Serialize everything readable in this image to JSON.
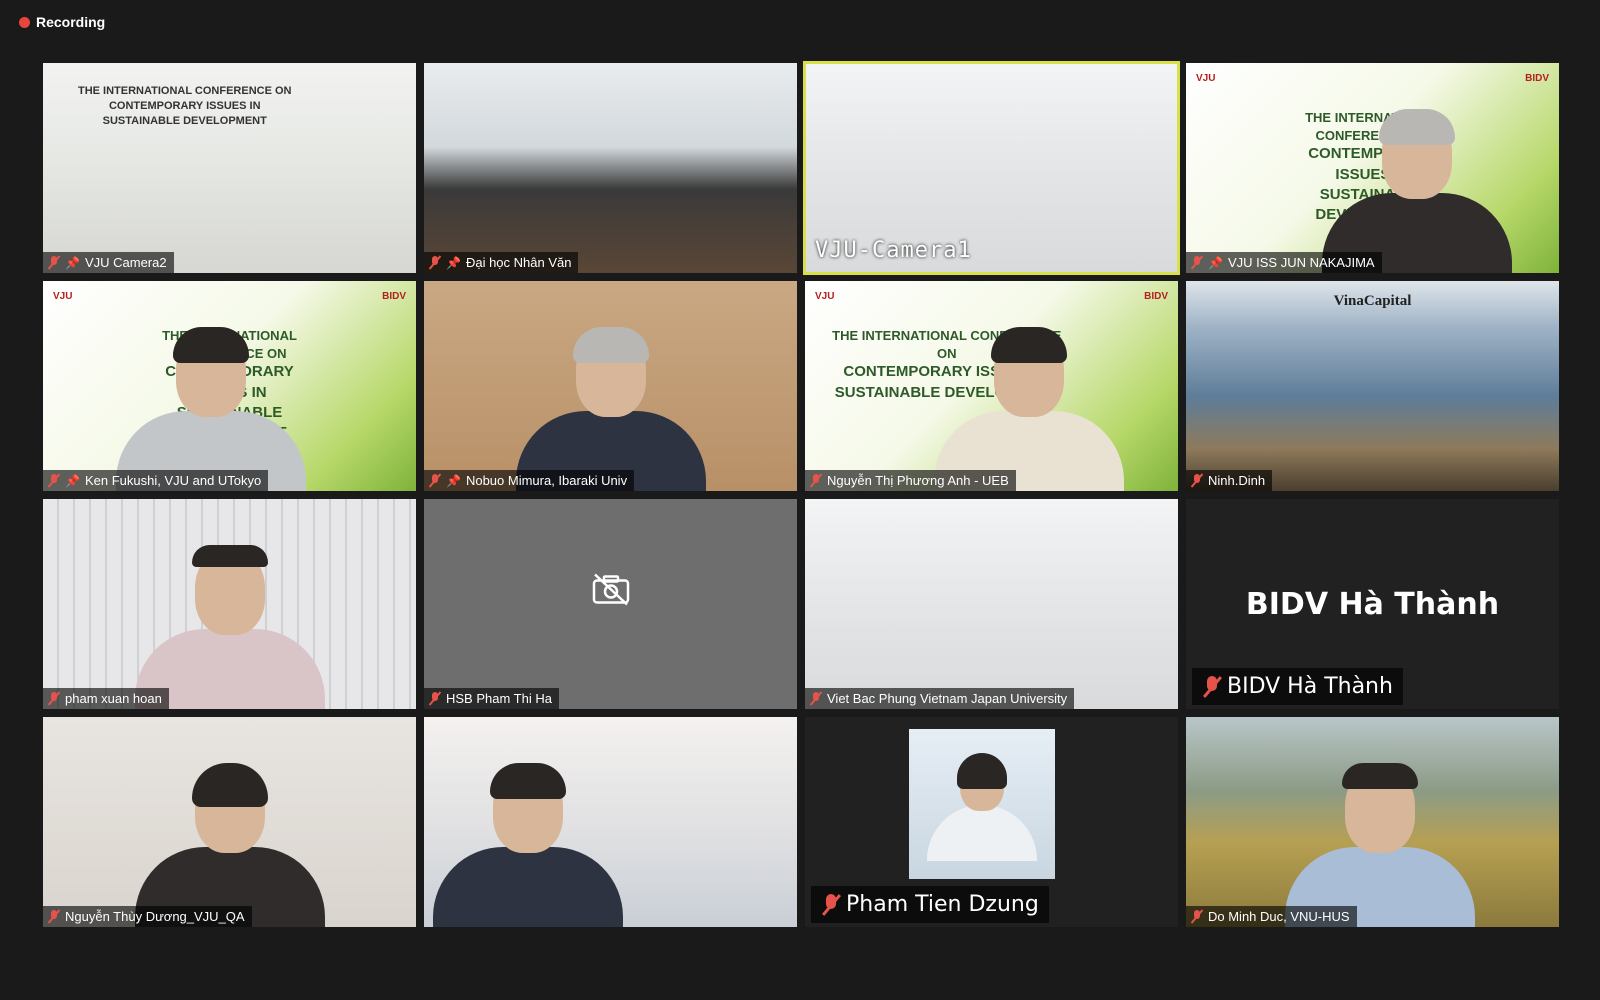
{
  "recording": {
    "label": "Recording",
    "dot_color": "#e8453c"
  },
  "tiles": [
    {
      "name": "VJU Camera2",
      "mic": "muted",
      "pinned": true
    },
    {
      "name": "Đại học Nhân Văn",
      "mic": "muted",
      "pinned": true
    },
    {
      "name": "VJU-Camera1",
      "mic": "muted",
      "pinned": false,
      "active_speaker": true
    },
    {
      "name": "VJU ISS JUN NAKAJIMA",
      "mic": "muted",
      "pinned": true
    },
    {
      "name": "Ken Fukushi, VJU and UTokyo",
      "mic": "muted",
      "pinned": true
    },
    {
      "name": "Nobuo Mimura, Ibaraki Univ",
      "mic": "muted",
      "pinned": true
    },
    {
      "name": "Nguyễn Thị Phương Anh - UEB",
      "mic": "muted",
      "pinned": false
    },
    {
      "name": "Ninh.Dinh",
      "mic": "muted",
      "pinned": false
    },
    {
      "name": "pham xuan hoan",
      "mic": "muted",
      "pinned": false
    },
    {
      "name": "HSB Pham Thi Ha",
      "mic": "muted",
      "pinned": false,
      "camera": "off"
    },
    {
      "name": "Viet Bac Phung Vietnam Japan University",
      "mic": "muted",
      "pinned": false
    },
    {
      "name": "BIDV Hà Thành",
      "mic": "muted",
      "pinned": false
    },
    {
      "name": "Nguyễn Thùy Dương_VJU_QA",
      "mic": "muted",
      "pinned": false
    },
    {
      "name": "",
      "mic": "none",
      "pinned": false
    },
    {
      "name": "Pham Tien Dzung",
      "mic": "muted",
      "pinned": false
    },
    {
      "name": "Do Minh Duc, VNU-HUS",
      "mic": "muted",
      "pinned": false
    }
  ],
  "bidv_display": "BIDV Hà Thành",
  "vinacapital_logo": "VinaCapital",
  "banner": {
    "vju_logo": "VJU",
    "bidv_logo": "BIDV",
    "line1": "THE INTERNATIONAL CONFERENCE ON",
    "line2": "CONTEMPORARY ISSUES IN",
    "line3": "SUSTAINABLE DEVELOPMENT"
  },
  "colors": {
    "active_border": "#d9e04a",
    "mic_muted": "#e5534b"
  }
}
